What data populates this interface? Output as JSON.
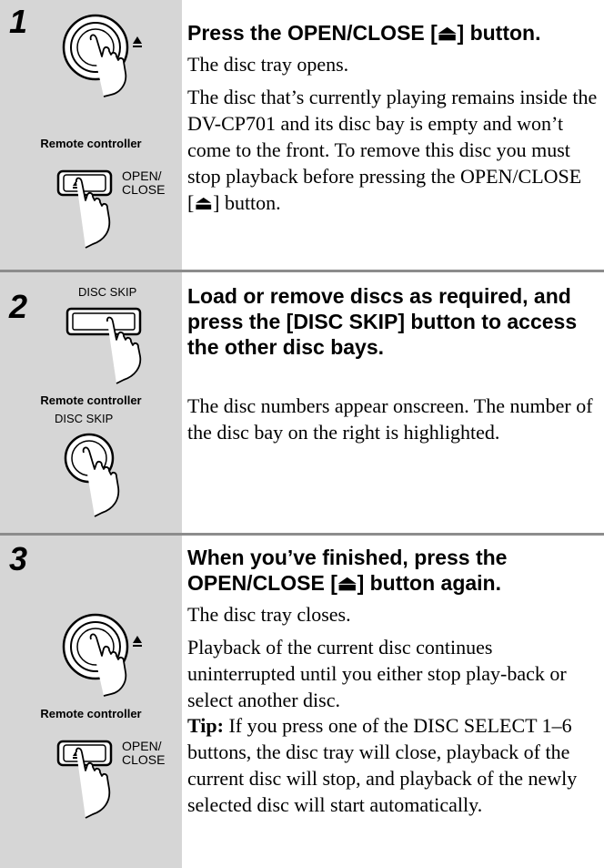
{
  "steps": [
    {
      "number": "1",
      "heading": "Press the OPEN/CLOSE [⏏] button.",
      "paragraphs": [
        "The disc tray opens.",
        "The disc that’s currently playing remains inside the DV-CP701 and its disc bay is empty and won’t come to the front. To remove this disc you must stop playback before pressing the OPEN/CLOSE [⏏] button."
      ],
      "remote_label": "Remote controller",
      "button_label_line1": "OPEN/",
      "button_label_line2": "CLOSE"
    },
    {
      "number": "2",
      "heading": "Load or remove discs as required, and press the [DISC SKIP] button to access the other disc bays.",
      "paragraphs": [
        "The disc numbers appear onscreen. The number of the disc bay on the right is highlighted."
      ],
      "unit_button_caption": "DISC SKIP",
      "remote_label": "Remote controller",
      "remote_button_caption": "DISC SKIP"
    },
    {
      "number": "3",
      "heading": "When you’ve finished, press the OPEN/CLOSE [⏏] button again.",
      "paragraphs": [
        "The disc tray closes.",
        "Playback of the current disc continues uninterrupted until you either stop play-back or select another disc."
      ],
      "tip_label": "Tip:",
      "tip_text": " If you press one of the DISC SELECT 1–6 buttons, the disc tray will close, playback of the current disc will stop, and playback of the newly selected disc will start automatically.",
      "remote_label": "Remote controller",
      "button_label_line1": "OPEN/",
      "button_label_line2": "CLOSE"
    }
  ]
}
